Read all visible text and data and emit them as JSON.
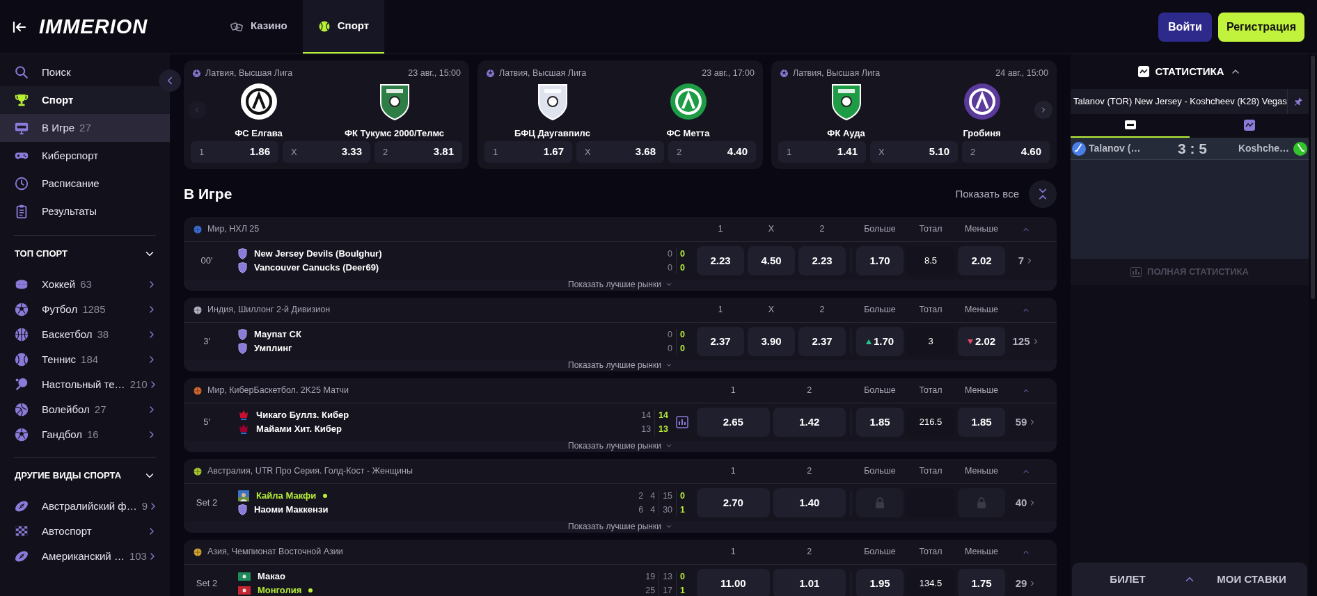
{
  "header": {
    "logo": "IMMERION",
    "tabs": [
      {
        "label": "Казино",
        "kind": "casino",
        "selected": false
      },
      {
        "label": "Спорт",
        "kind": "sport",
        "selected": true
      }
    ],
    "login": "Войти",
    "register": "Регистрация"
  },
  "sidebar": {
    "nav": [
      {
        "label": "Поиск",
        "kind": "search",
        "selected": false,
        "highlighted": false
      },
      {
        "label": "Спорт",
        "kind": "trophy",
        "selected": false,
        "highlighted": true
      },
      {
        "label": "В Игре",
        "count": "27",
        "kind": "live",
        "selected": true,
        "highlighted": false
      },
      {
        "label": "Киберспорт",
        "kind": "gamepad",
        "selected": false,
        "highlighted": false
      },
      {
        "label": "Расписание",
        "kind": "clock",
        "selected": false,
        "highlighted": false
      },
      {
        "label": "Результаты",
        "kind": "clipboard",
        "selected": false,
        "highlighted": false
      }
    ],
    "sections": [
      {
        "title": "ТОП СПОРТ",
        "expanded": true,
        "items": [
          {
            "label": "Хоккей",
            "count": "63",
            "kind": "hockey"
          },
          {
            "label": "Футбол",
            "count": "1285",
            "kind": "football"
          },
          {
            "label": "Баскетбол",
            "count": "38",
            "kind": "basketball"
          },
          {
            "label": "Теннис",
            "count": "184",
            "kind": "tennis"
          },
          {
            "label": "Настольный те…",
            "count": "210",
            "kind": "tabletennis"
          },
          {
            "label": "Волейбол",
            "count": "27",
            "kind": "volleyball"
          },
          {
            "label": "Гандбол",
            "count": "16",
            "kind": "football"
          }
        ]
      },
      {
        "title": "ДРУГИЕ ВИДЫ СПОРТА",
        "expanded": true,
        "items": [
          {
            "label": "Австралийский ф…",
            "count": "9",
            "kind": "rugby"
          },
          {
            "label": "Автоспорт",
            "kind": "flag"
          },
          {
            "label": "Американский …",
            "count": "103",
            "kind": "rugby"
          }
        ]
      }
    ]
  },
  "featured": [
    {
      "league": "Латвия, Высшая Лига",
      "date": "23 авг., 15:00",
      "teams": [
        {
          "name": "ФС Елгава",
          "kind": "circle"
        },
        {
          "name": "ФК Тукумс 2000/Телмс",
          "kind": "shield",
          "color": "#2f7d46"
        }
      ],
      "odds": [
        {
          "label": "1",
          "value": "1.86"
        },
        {
          "label": "X",
          "value": "3.33"
        },
        {
          "label": "2",
          "value": "3.81"
        }
      ]
    },
    {
      "league": "Латвия, Высшая Лига",
      "date": "23 авг., 17:00",
      "teams": [
        {
          "name": "БФЦ Даугавпилс",
          "kind": "shield",
          "color": "#dfe3ee"
        },
        {
          "name": "ФС Метта",
          "kind": "circle",
          "color": "#1e9b45"
        }
      ],
      "odds": [
        {
          "label": "1",
          "value": "1.67"
        },
        {
          "label": "X",
          "value": "3.68"
        },
        {
          "label": "2",
          "value": "4.40"
        }
      ]
    },
    {
      "league": "Латвия, Высшая Лига",
      "date": "24 авг., 15:00",
      "teams": [
        {
          "name": "ФК Ауда",
          "kind": "shield",
          "color": "#1e9b45"
        },
        {
          "name": "Гробиня",
          "kind": "circle",
          "color": "#5a3a9a"
        }
      ],
      "odds": [
        {
          "label": "1",
          "value": "1.41"
        },
        {
          "label": "X",
          "value": "5.10"
        },
        {
          "label": "2",
          "value": "4.60"
        }
      ]
    }
  ],
  "live": {
    "title": "В Игре",
    "show_all": "Показать все",
    "events": [
      {
        "league": "Мир, НХЛ 25",
        "kind": "hockey",
        "time": "00′",
        "expanded": true,
        "odds_columns": [
          "1",
          "X",
          "2"
        ],
        "total_columns": [
          "Больше",
          "Тотал",
          "Меньше"
        ],
        "stats": false,
        "teams": [
          {
            "name": "New Jersey Devils (Boulghur)",
            "kind": "shield",
            "serving": false,
            "scores": [
              "0",
              "0"
            ]
          },
          {
            "name": "Vancouver Canucks (Deer69)",
            "kind": "shield",
            "serving": false,
            "scores": [
              "0",
              "0"
            ]
          }
        ],
        "odds": [
          {
            "value": "2.23"
          },
          {
            "value": "4.50"
          },
          {
            "value": "2.23"
          }
        ],
        "totals": [
          {
            "kind": "odd",
            "value": "1.70"
          },
          {
            "kind": "line",
            "value": "8.5"
          },
          {
            "kind": "odd",
            "value": "2.02"
          }
        ],
        "more": "7",
        "show_markets": "Показать лучшие рынки"
      },
      {
        "league": "Индия, Шиллонг 2-й Дивизион",
        "kind": "football",
        "time": "3′",
        "expanded": true,
        "odds_columns": [
          "1",
          "X",
          "2"
        ],
        "total_columns": [
          "Больше",
          "Тотал",
          "Меньше"
        ],
        "stats": false,
        "teams": [
          {
            "name": "Маупат СК",
            "kind": "shield",
            "serving": false,
            "scores": [
              "0",
              "0"
            ]
          },
          {
            "name": "Умплинг",
            "kind": "shield",
            "serving": false,
            "scores": [
              "0",
              "0"
            ]
          }
        ],
        "odds": [
          {
            "value": "2.37"
          },
          {
            "value": "3.90"
          },
          {
            "value": "2.37"
          }
        ],
        "totals": [
          {
            "kind": "odd",
            "value": "1.70",
            "rising": true
          },
          {
            "kind": "line",
            "value": "3"
          },
          {
            "kind": "odd",
            "value": "2.02",
            "rising": false
          }
        ],
        "more": "125",
        "show_markets": "Показать лучшие рынки"
      },
      {
        "league": "Мир, КиберБаскетбол. 2K25 Матчи",
        "kind": "basketball",
        "time": "5′",
        "expanded": true,
        "odds_columns": [
          "1",
          "2"
        ],
        "total_columns": [
          "Больше",
          "Тотал",
          "Меньше"
        ],
        "stats": true,
        "teams": [
          {
            "name": "Чикаго Буллз. Кибер",
            "kind": "crest",
            "color": "#c8102e",
            "serving": false,
            "scores": [
              "14",
              "14"
            ]
          },
          {
            "name": "Майами Хит. Кибер",
            "kind": "crest",
            "color": "#98002e",
            "serving": false,
            "scores": [
              "13",
              "13"
            ]
          }
        ],
        "odds": [
          {
            "value": "2.65"
          },
          {
            "value": "1.42"
          }
        ],
        "totals": [
          {
            "kind": "odd",
            "value": "1.85"
          },
          {
            "kind": "line",
            "value": "216.5"
          },
          {
            "kind": "odd",
            "value": "1.85"
          }
        ],
        "more": "59",
        "show_markets": "Показать лучшие рынки"
      },
      {
        "league": "Австралия, UTR Про Серия. Голд-Кост - Женщины",
        "kind": "tennis",
        "time": "Set 2",
        "expanded": true,
        "odds_columns": [
          "1",
          "2"
        ],
        "total_columns": [
          "Больше",
          "Тотал",
          "Меньше"
        ],
        "stats": false,
        "teams": [
          {
            "name": "Кайла Макфи",
            "serving": true,
            "scores": [
              "2",
              "4",
              "15",
              "0"
            ]
          },
          {
            "name": "Наоми Маккензи",
            "kind": "shield",
            "serving": false,
            "scores": [
              "6",
              "4",
              "30",
              "1"
            ]
          }
        ],
        "odds": [
          {
            "value": "2.70"
          },
          {
            "value": "1.40"
          }
        ],
        "totals": [
          {
            "kind": "locked"
          },
          {
            "kind": "empty"
          },
          {
            "kind": "locked"
          }
        ],
        "more": "40",
        "show_markets": "Показать лучшие рынки"
      },
      {
        "league": "Азия, Чемпионат Восточной Азии",
        "kind": "volleyball",
        "time": "Set 2",
        "expanded": true,
        "odds_columns": [
          "1",
          "2"
        ],
        "total_columns": [
          "Больше",
          "Тотал",
          "Меньше"
        ],
        "stats": false,
        "teams": [
          {
            "name": "Макао",
            "kind": "flag",
            "color": "#1f8a5b",
            "serving": false,
            "scores": [
              "19",
              "13",
              "0"
            ]
          },
          {
            "name": "Монголия",
            "kind": "flag",
            "color": "#c4272f",
            "serving": true,
            "scores": [
              "25",
              "17",
              "1"
            ]
          }
        ],
        "odds": [
          {
            "value": "11.00"
          },
          {
            "value": "1.01"
          }
        ],
        "totals": [
          {
            "kind": "odd",
            "value": "1.95"
          },
          {
            "kind": "line",
            "value": "134.5"
          },
          {
            "kind": "odd",
            "value": "1.75"
          }
        ],
        "more": "29"
      }
    ]
  },
  "stats_panel": {
    "title": "СТАТИСТИКА",
    "expanded": true,
    "match": "Talanov (TOR) New Jersey - Koshcheev (K28) Vegas",
    "tabs": [
      {
        "kind": "live",
        "selected": true
      },
      {
        "kind": "chart",
        "selected": false
      }
    ],
    "home": "Talanov (…",
    "score": "3 : 5",
    "away": "Koshche…",
    "full_stats": "ПОЛНАЯ СТАТИСТИКА"
  },
  "betslip": {
    "ticket": "БИЛЕТ",
    "my_bets": "МОИ СТАВКИ",
    "expanded": false
  }
}
